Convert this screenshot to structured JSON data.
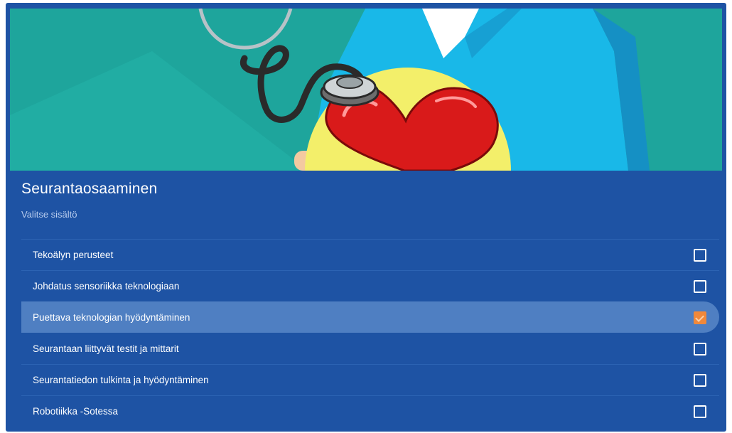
{
  "section": {
    "title": "Seurantaosaaminen",
    "subtitle": "Valitse sisältö"
  },
  "items": [
    {
      "label": "Tekoälyn perusteet",
      "checked": false
    },
    {
      "label": "Johdatus sensoriikka teknologiaan",
      "checked": false
    },
    {
      "label": "Puettava teknologian hyödyntäminen",
      "checked": true
    },
    {
      "label": "Seurantaan liittyvät testit ja mittarit",
      "checked": false
    },
    {
      "label": "Seurantatiedon tulkinta ja hyödyntäminen",
      "checked": false
    },
    {
      "label": "Robotiikka -Sotessa",
      "checked": false
    }
  ],
  "colors": {
    "panel": "#1e53a4",
    "hero_background": "#1ea59c",
    "selected_row": "#4f7fc2",
    "checkbox_checked": "#f0883a"
  },
  "hero_image": {
    "icon": "doctor-heart-stethoscope-illustration"
  }
}
